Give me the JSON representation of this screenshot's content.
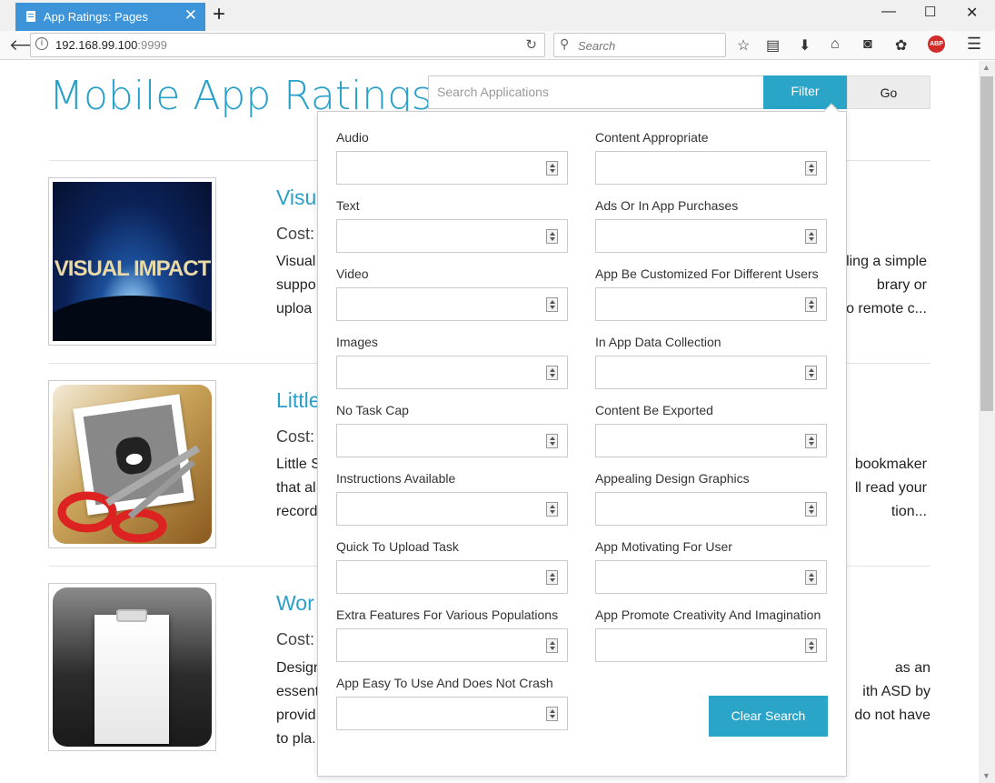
{
  "browser": {
    "tab_title": "App Ratings: Pages",
    "url_host": "192.168.99.100",
    "url_port": ":9999",
    "search_placeholder": "Search"
  },
  "page": {
    "title": "Mobile App Ratings",
    "search_placeholder": "Search Applications",
    "filter_label": "Filter",
    "go_label": "Go"
  },
  "apps": [
    {
      "title": "Visua",
      "cost_label": "Cost:",
      "desc_left": [
        "Visual",
        "suppo",
        "uploa"
      ],
      "desc_right": [
        "ling a simple",
        "brary or",
        "o remote c..."
      ]
    },
    {
      "title": "Little",
      "cost_label": "Cost:",
      "desc_left": [
        "Little S",
        "that al",
        "record"
      ],
      "desc_right": [
        "bookmaker",
        "ll read your",
        "tion..."
      ]
    },
    {
      "title": "Wor",
      "cost_label": "Cost:",
      "desc_left": [
        "Design",
        "essent",
        "provid",
        "to pla."
      ],
      "desc_right": [
        "as an",
        "ith ASD by",
        "do not have"
      ]
    }
  ],
  "filters": {
    "left": [
      "Audio",
      "Text",
      "Video",
      "Images",
      "No Task Cap",
      "Instructions Available",
      "Quick To Upload Task",
      "Extra Features For Various Populations",
      "App Easy To Use And Does Not Crash"
    ],
    "right": [
      "Content Appropriate",
      "Ads Or In App Purchases",
      "App Be Customized For Different Users",
      "In App Data Collection",
      "Content Be Exported",
      "Appealing Design Graphics",
      "App Motivating For User",
      "App Promote Creativity And Imagination"
    ],
    "clear_label": "Clear Search"
  },
  "colors": {
    "accent": "#2ba5c7",
    "title": "#29a0c9",
    "tab": "#3d94d9"
  }
}
